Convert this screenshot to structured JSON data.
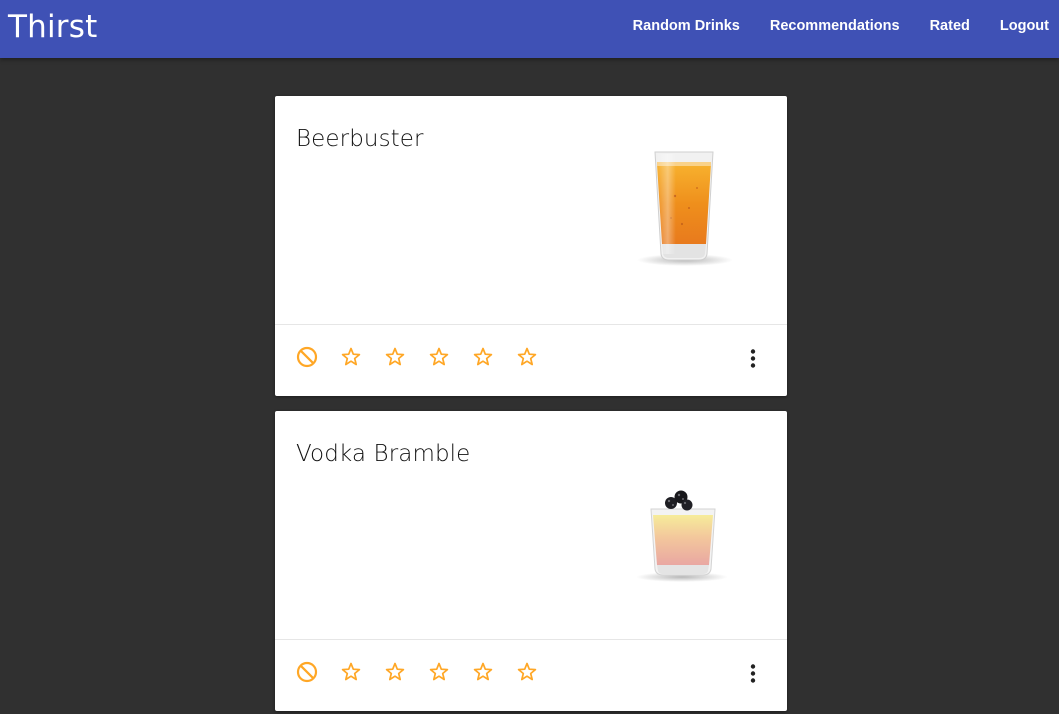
{
  "app": {
    "title": "Thirst"
  },
  "nav": {
    "items": [
      "Random Drinks",
      "Recommendations",
      "Rated",
      "Logout"
    ]
  },
  "colors": {
    "header": "#3f51b5",
    "background": "#303030",
    "accent_star": "#ffa726",
    "card": "#ffffff"
  },
  "drinks": [
    {
      "name": "Beerbuster",
      "image_icon": "beer-glass-icon",
      "rating": 0,
      "max_rating": 5
    },
    {
      "name": "Vodka Bramble",
      "image_icon": "bramble-cocktail-icon",
      "rating": 0,
      "max_rating": 5
    }
  ]
}
